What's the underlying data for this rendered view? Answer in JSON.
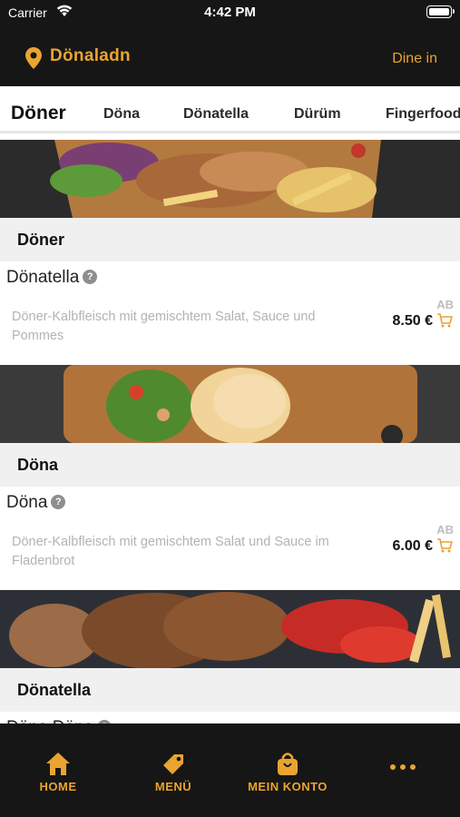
{
  "status": {
    "carrier": "Carrier",
    "time": "4:42 PM"
  },
  "header": {
    "brand": "Dönaladn",
    "mode": "Dine in"
  },
  "tabs": [
    "Döner",
    "Döna",
    "Dönatella",
    "Dürüm",
    "Fingerfood"
  ],
  "sections": [
    {
      "title": "Döner",
      "item": {
        "name": "Dönatella",
        "description": "Döner-Kalbfleisch mit gemischtem Salat, Sauce und Pommes",
        "price_prefix": "AB",
        "price": "8.50 €"
      }
    },
    {
      "title": "Döna",
      "item": {
        "name": "Döna",
        "description": "Döner-Kalbfleisch mit gemischtem Salat und Sauce im Fladenbrot",
        "price_prefix": "AB",
        "price": "6.00 €"
      }
    },
    {
      "title": "Dönatella",
      "item": {
        "name": "Döna Döna",
        "description": "",
        "price_prefix": "",
        "price": ""
      }
    }
  ],
  "bottom_nav": [
    {
      "label": "HOME",
      "icon": "home-icon"
    },
    {
      "label": "MENÜ",
      "icon": "tag-icon"
    },
    {
      "label": "MEIN KONTO",
      "icon": "bag-icon"
    },
    {
      "label": "",
      "icon": "more-icon"
    }
  ],
  "colors": {
    "accent": "#e9a431",
    "bar": "#161616",
    "background": "#f0f0f0"
  }
}
